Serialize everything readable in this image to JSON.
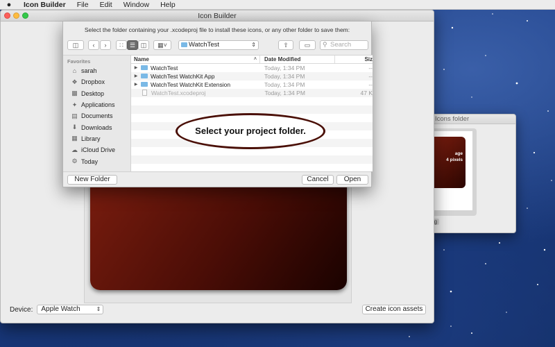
{
  "menubar": {
    "apple": "",
    "items": [
      "Icon Builder",
      "File",
      "Edit",
      "Window",
      "Help"
    ]
  },
  "main_window": {
    "title": "Icon Builder",
    "device_label": "Device:",
    "device_value": "Apple Watch",
    "create_button": "Create icon assets"
  },
  "side_window": {
    "title": "Icons folder",
    "image_text_1": "age",
    "image_text_2": "4 pixels",
    "file_label": "n.png"
  },
  "dialog": {
    "message": "Select the folder containing your .xcodeproj file to install these icons, or any other folder to save them:",
    "location": "WatchTest",
    "search_placeholder": "Search",
    "sidebar": {
      "heading": "Favorites",
      "items": [
        {
          "label": "sarah",
          "icon": "home-icon"
        },
        {
          "label": "Dropbox",
          "icon": "dropbox-icon"
        },
        {
          "label": "Desktop",
          "icon": "desktop-icon"
        },
        {
          "label": "Applications",
          "icon": "applications-icon"
        },
        {
          "label": "Documents",
          "icon": "documents-icon"
        },
        {
          "label": "Downloads",
          "icon": "downloads-icon"
        },
        {
          "label": "Library",
          "icon": "library-icon"
        },
        {
          "label": "iCloud Drive",
          "icon": "cloud-icon"
        },
        {
          "label": "Today",
          "icon": "gear-icon"
        }
      ]
    },
    "columns": {
      "name": "Name",
      "date": "Date Modified",
      "size": "Siz"
    },
    "files": [
      {
        "name": "WatchTest",
        "date": "Today, 1:34 PM",
        "size": "--",
        "kind": "folder"
      },
      {
        "name": "WatchTest WatchKit App",
        "date": "Today, 1:34 PM",
        "size": "--",
        "kind": "folder"
      },
      {
        "name": "WatchTest WatchKit Extension",
        "date": "Today, 1:34 PM",
        "size": "--",
        "kind": "folder"
      },
      {
        "name": "WatchTest.xcodeproj",
        "date": "Today, 1:34 PM",
        "size": "47 K",
        "kind": "file"
      }
    ],
    "callout": "Select your project folder.",
    "new_folder_button": "New Folder",
    "cancel_button": "Cancel",
    "open_button": "Open"
  }
}
